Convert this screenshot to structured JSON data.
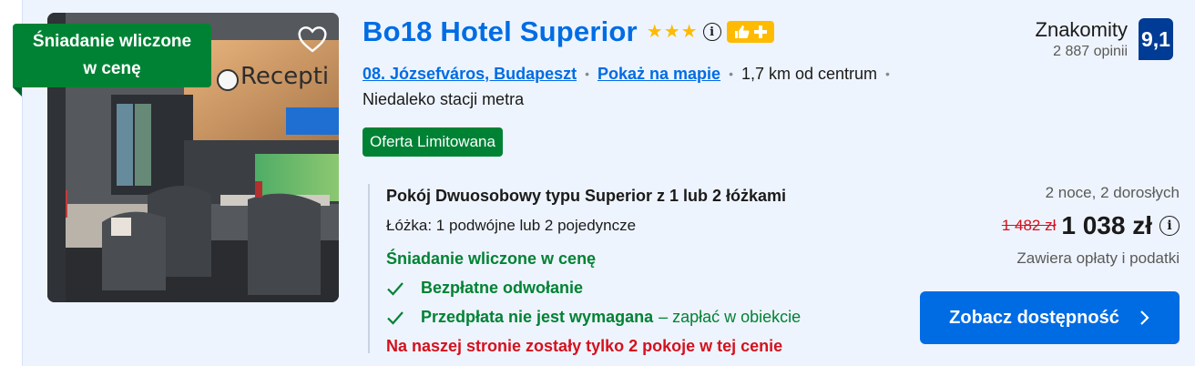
{
  "hotel": {
    "name": "Bo18 Hotel Superior",
    "stars": 3,
    "ribbon": "Śniadanie wliczone w cenę",
    "district": "08. Józsefváros, Budapeszt",
    "map_link": "Pokaż na mapie",
    "distance": "1,7 km od centrum",
    "metro": "Niedaleko stacji metra",
    "deal_badge": "Oferta Limitowana"
  },
  "review": {
    "word": "Znakomity",
    "count": "2 887 opinii",
    "score": "9,1"
  },
  "room": {
    "name": "Pokój Dwuosobowy typu Superior z 1 lub 2 łóżkami",
    "beds": "Łóżka: 1 podwójne lub 2 pojedyncze",
    "breakfast": "Śniadanie wliczone w cenę",
    "features": [
      {
        "bold": "Bezpłatne odwołanie",
        "rest": ""
      },
      {
        "bold": "Przedpłata nie jest wymagana",
        "rest": "– zapłać w obiekcie"
      }
    ],
    "scarcity": "Na naszej stronie zostały tylko 2 pokoje w tej cenie"
  },
  "price": {
    "stay": "2 noce, 2 dorosłych",
    "old": "1 482 zł",
    "new": "1 038 zł",
    "taxes": "Zawiera opłaty i podatki"
  },
  "cta": {
    "label": "Zobacz dostępność"
  },
  "colors": {
    "brand_blue": "#006ce4",
    "score_blue": "#003b95",
    "green": "#008234",
    "red": "#d4111e",
    "star_yellow": "#febb02",
    "card_bg": "#eef4fd"
  },
  "icons": {
    "favorite": "heart-icon",
    "info": "info-icon",
    "genius": "thumbs-up-plus-icon",
    "check": "check-icon",
    "chevron": "chevron-right-icon"
  }
}
